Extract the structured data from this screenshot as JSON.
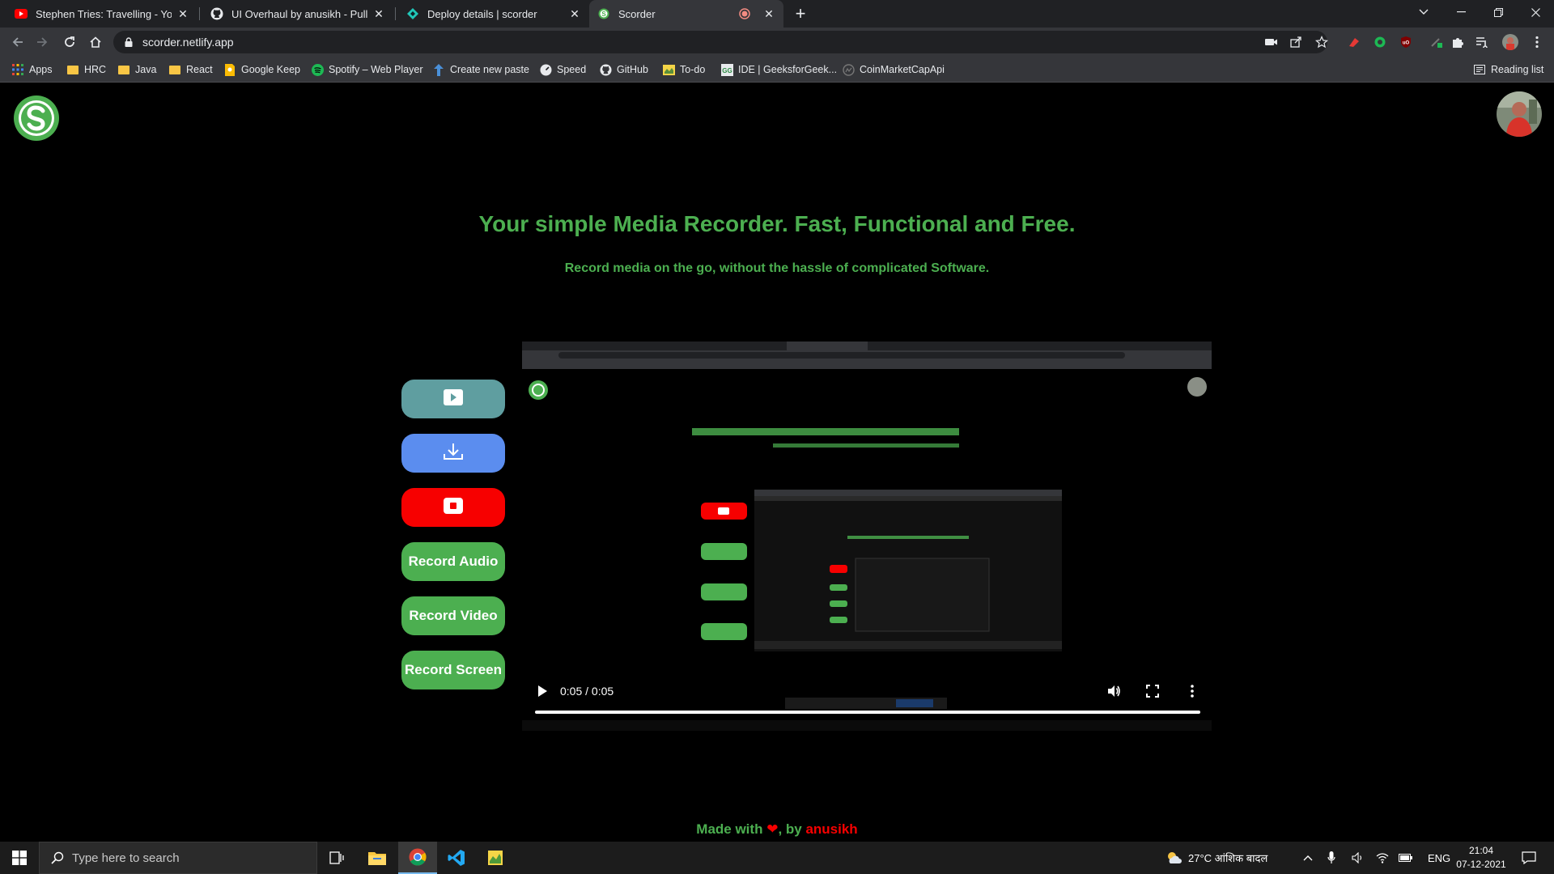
{
  "browser": {
    "tabs": [
      {
        "title": "Stephen Tries: Travelling - YouTube",
        "icon": "youtube-icon"
      },
      {
        "title": "UI Overhaul by anusikh - Pull Request",
        "icon": "github-icon"
      },
      {
        "title": "Deploy details | scorder",
        "icon": "netlify-icon"
      },
      {
        "title": "Scorder",
        "icon": "scorder-icon",
        "active": true,
        "recording": true
      }
    ],
    "url": "scorder.netlify.app",
    "bookmarks": [
      {
        "label": "Apps",
        "icon": "apps-grid-icon"
      },
      {
        "label": "HRC",
        "icon": "folder-icon"
      },
      {
        "label": "Java",
        "icon": "folder-icon"
      },
      {
        "label": "React",
        "icon": "folder-icon"
      },
      {
        "label": "Google Keep",
        "icon": "keep-icon"
      },
      {
        "label": "Spotify – Web Player",
        "icon": "spotify-icon"
      },
      {
        "label": "Create new paste",
        "icon": "paste-icon"
      },
      {
        "label": "Speed",
        "icon": "speed-icon"
      },
      {
        "label": "GitHub",
        "icon": "github-icon"
      },
      {
        "label": "To-do",
        "icon": "todo-icon"
      },
      {
        "label": "IDE | GeeksforGeek...",
        "icon": "gfg-icon"
      },
      {
        "label": "CoinMarketCapApi",
        "icon": "coinmarketcap-icon"
      }
    ],
    "reading_list": "Reading list"
  },
  "page": {
    "headline": "Your simple Media Recorder. Fast, Functional and Free.",
    "subline": "Record media on the go, without the hassle of complicated Software.",
    "buttons": {
      "record_audio": "Record Audio",
      "record_video": "Record Video",
      "record_screen": "Record Screen"
    },
    "video": {
      "time": "0:05 / 0:05",
      "progress": 1.0
    },
    "footer": {
      "prefix": "Made with ",
      "heart": "❤",
      "middle": ", by ",
      "author": "anusikh"
    }
  },
  "taskbar": {
    "search_placeholder": "Type here to search",
    "weather": "27°C  आंशिक बादल",
    "language": "ENG",
    "time": "21:04",
    "date": "07-12-2021"
  },
  "colors": {
    "accent_green": "#4caf50",
    "play_teal": "#5f9ea0",
    "download_blue": "#5b8def",
    "stop_red": "#f70000"
  }
}
